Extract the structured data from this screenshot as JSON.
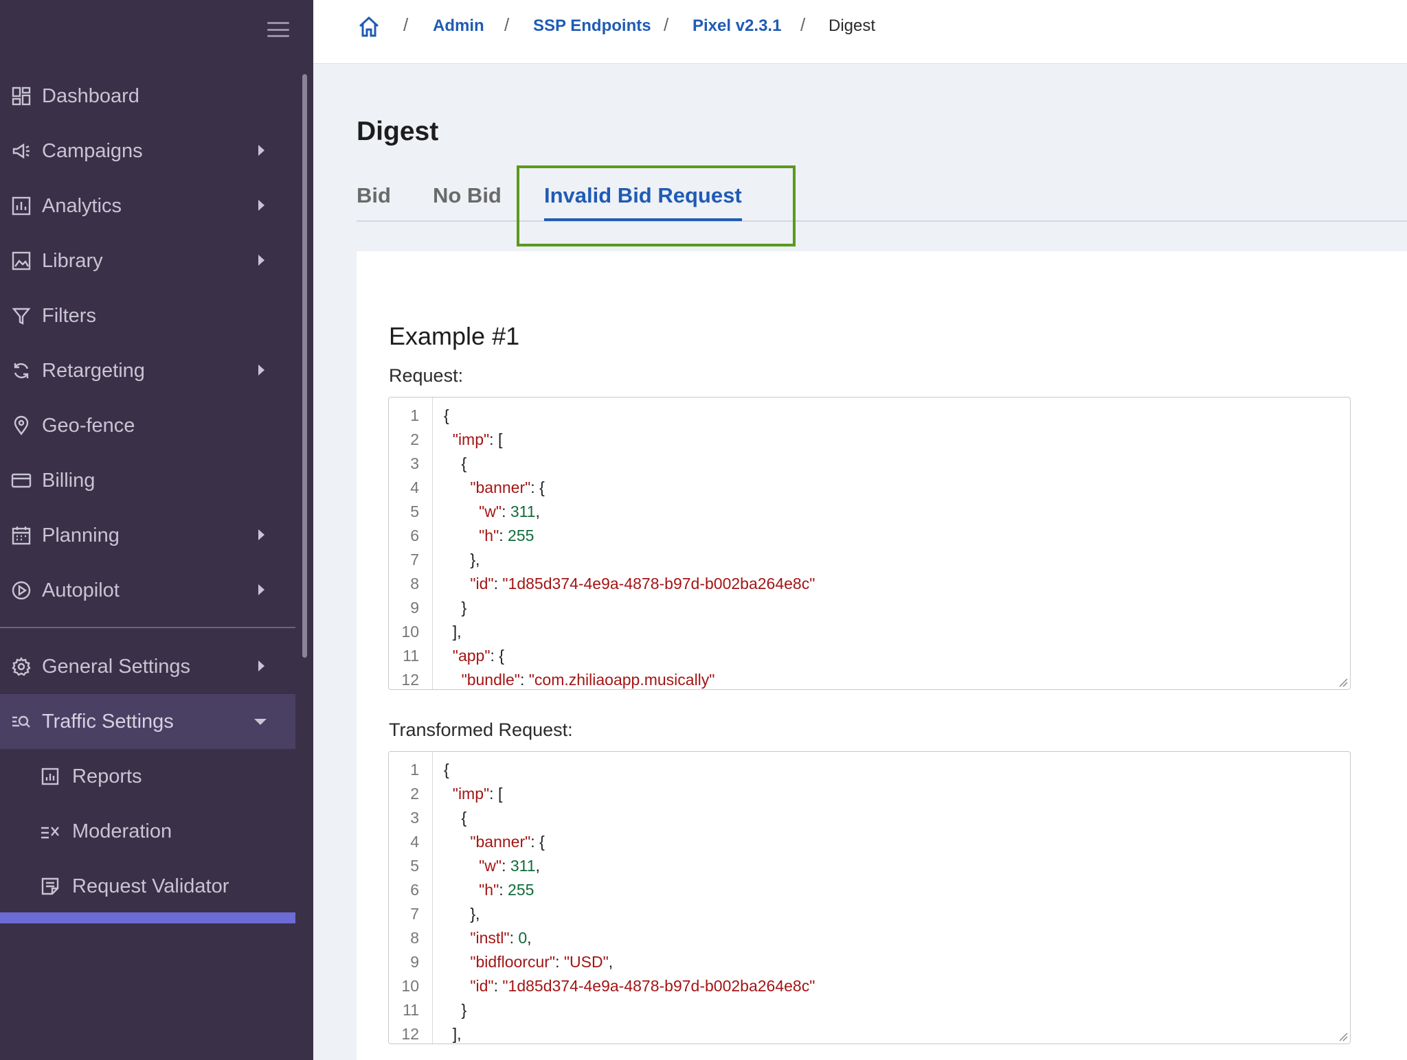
{
  "sidebar": {
    "items": [
      {
        "label": "Dashboard",
        "icon": "dashboard-icon",
        "has_submenu": false
      },
      {
        "label": "Campaigns",
        "icon": "megaphone-icon",
        "has_submenu": true
      },
      {
        "label": "Analytics",
        "icon": "bar-chart-icon",
        "has_submenu": true
      },
      {
        "label": "Library",
        "icon": "image-icon",
        "has_submenu": true
      },
      {
        "label": "Filters",
        "icon": "filter-icon",
        "has_submenu": false
      },
      {
        "label": "Retargeting",
        "icon": "refresh-icon",
        "has_submenu": true
      },
      {
        "label": "Geo-fence",
        "icon": "map-pin-icon",
        "has_submenu": false
      },
      {
        "label": "Billing",
        "icon": "credit-card-icon",
        "has_submenu": false
      },
      {
        "label": "Planning",
        "icon": "calendar-icon",
        "has_submenu": true
      },
      {
        "label": "Autopilot",
        "icon": "play-circle-icon",
        "has_submenu": true
      }
    ],
    "settings": [
      {
        "label": "General Settings",
        "icon": "gear-icon",
        "has_submenu": true
      },
      {
        "label": "Traffic Settings",
        "icon": "traffic-search-icon",
        "expanded": true
      }
    ],
    "sub_items": [
      {
        "label": "Reports",
        "icon": "report-chart-icon"
      },
      {
        "label": "Moderation",
        "icon": "checklist-icon"
      },
      {
        "label": "Request Validator",
        "icon": "document-edit-icon"
      }
    ]
  },
  "breadcrumb": {
    "items": [
      "Admin",
      "SSP Endpoints",
      "Pixel v2.3.1"
    ],
    "current": "Digest",
    "separator": "/"
  },
  "page": {
    "title": "Digest",
    "tabs": [
      "Bid",
      "No Bid",
      "Invalid Bid Request"
    ],
    "active_tab": "Invalid Bid Request"
  },
  "example": {
    "title": "Example #1",
    "request_label": "Request:",
    "transformed_label": "Transformed Request:",
    "request_lines": [
      [
        "{"
      ],
      [
        "  ",
        "\"imp\"",
        ": ["
      ],
      [
        "    {"
      ],
      [
        "      ",
        "\"banner\"",
        ": {"
      ],
      [
        "        ",
        "\"w\"",
        ": ",
        "311",
        ","
      ],
      [
        "        ",
        "\"h\"",
        ": ",
        "255",
        ""
      ],
      [
        "      },"
      ],
      [
        "      ",
        "\"id\"",
        ": ",
        "\"1d85d374-4e9a-4878-b97d-b002ba264e8c\"",
        ""
      ],
      [
        "    }"
      ],
      [
        "  ],"
      ],
      [
        "  ",
        "\"app\"",
        ": {"
      ],
      [
        "    ",
        "\"bundle\"",
        ": ",
        "\"com.zhiliaoapp.musically\"",
        ""
      ]
    ],
    "transformed_lines": [
      [
        "{"
      ],
      [
        "  ",
        "\"imp\"",
        ": ["
      ],
      [
        "    {"
      ],
      [
        "      ",
        "\"banner\"",
        ": {"
      ],
      [
        "        ",
        "\"w\"",
        ": ",
        "311",
        ","
      ],
      [
        "        ",
        "\"h\"",
        ": ",
        "255",
        ""
      ],
      [
        "      },"
      ],
      [
        "      ",
        "\"instl\"",
        ": ",
        "0",
        ","
      ],
      [
        "      ",
        "\"bidfloorcur\"",
        ": ",
        "\"USD\"",
        ","
      ],
      [
        "      ",
        "\"id\"",
        ": ",
        "\"1d85d374-4e9a-4878-b97d-b002ba264e8c\"",
        ""
      ],
      [
        "    }"
      ],
      [
        "  ],"
      ]
    ]
  },
  "colors": {
    "sidebar_bg": "#3a3148",
    "accent": "#1f5bb5",
    "highlight": "#5a9a1e",
    "json_key": "#a31515",
    "json_number": "#116b3a"
  }
}
